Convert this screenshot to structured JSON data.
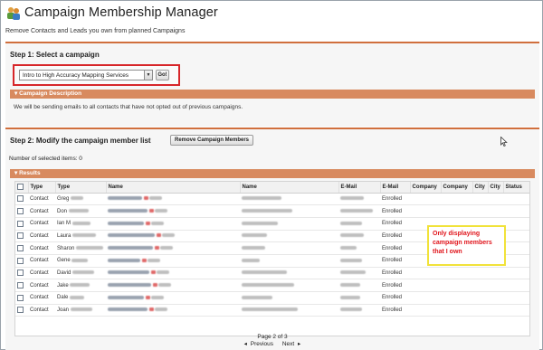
{
  "header": {
    "title": "Campaign Membership Manager",
    "subtitle": "Remove Contacts and Leads you own from planned Campaigns",
    "icon": "people-icon"
  },
  "step1": {
    "title": "Step 1: Select a campaign",
    "selected_campaign": "Intro to High Accuracy Mapping Services",
    "go_label": "Go!",
    "description_header": "Campaign Description",
    "description_text": "We will be sending emails to all contacts that have not opted out of previous campaigns."
  },
  "step2": {
    "title": "Step 2: Modify the campaign member list",
    "remove_button": "Remove Campaign Members",
    "selected_count": "Number of selected items: 0",
    "results_header": "Results"
  },
  "table": {
    "columns": [
      "Type",
      "Type",
      "Name",
      "Name",
      "E-Mail",
      "E-Mail",
      "Company",
      "Company",
      "City",
      "City",
      "Status"
    ],
    "rows": [
      {
        "type": "Contact",
        "first": "Greg",
        "status": "Enrolled"
      },
      {
        "type": "Contact",
        "first": "Don",
        "status": "Enrolled"
      },
      {
        "type": "Contact",
        "first": "Ian M",
        "status": "Enrolled"
      },
      {
        "type": "Contact",
        "first": "Laura",
        "status": "Enrolled"
      },
      {
        "type": "Contact",
        "first": "Sharon",
        "status": "Enrolled"
      },
      {
        "type": "Contact",
        "first": "Gene",
        "status": "Enrolled"
      },
      {
        "type": "Contact",
        "first": "David",
        "status": "Enrolled"
      },
      {
        "type": "Contact",
        "first": "Jake",
        "status": "Enrolled"
      },
      {
        "type": "Contact",
        "first": "Dale",
        "status": "Enrolled"
      },
      {
        "type": "Contact",
        "first": "Joan",
        "status": "Enrolled"
      }
    ]
  },
  "callout": {
    "text": "Only displaying\ncampaign members\nthat I own"
  },
  "pager": {
    "page": "Page 2 of 3",
    "previous": "Previous",
    "next": "Next"
  },
  "colors": {
    "accent_orange": "#d88a5f",
    "highlight_red": "#d7262a",
    "callout_yellow": "#f1e23a"
  }
}
